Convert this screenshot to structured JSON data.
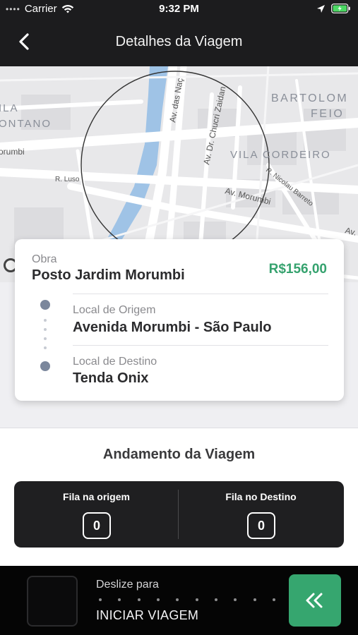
{
  "status_bar": {
    "signal": "Carrier",
    "time": "9:32 PM"
  },
  "nav": {
    "title": "Detalhes da Viagem",
    "back_icon": "chevron-left-icon"
  },
  "map": {
    "labels": [
      "ILA",
      "ONTANO",
      "orumbi",
      "R. Luso",
      "Av. das Naç",
      "Av. Dr. Chucri Zaidan",
      "BARTOLOM",
      "FEIO",
      "VILA CORDEIRO",
      "R. Nicolau Barreto",
      "Av. Morumbi",
      "Av."
    ]
  },
  "trip": {
    "obra_label": "Obra",
    "obra_name": "Posto Jardim Morumbi",
    "price": "R$156,00",
    "origin_label": "Local de Origem",
    "origin_value": "Avenida Morumbi - São Paulo",
    "destination_label": "Local de Destino",
    "destination_value": "Tenda Onix"
  },
  "progress": {
    "title": "Andamento da Viagem",
    "queues": [
      {
        "label": "Fila na origem",
        "value": "0"
      },
      {
        "label": "Fila no Destino",
        "value": "0"
      }
    ]
  },
  "slider": {
    "hint": "Deslize para",
    "action": "INICIAR VIAGEM",
    "button_icon": "double-chevron-left-icon"
  },
  "colors": {
    "accent": "#36a66f",
    "price": "#35a26e",
    "dark": "#1c1c1e"
  }
}
